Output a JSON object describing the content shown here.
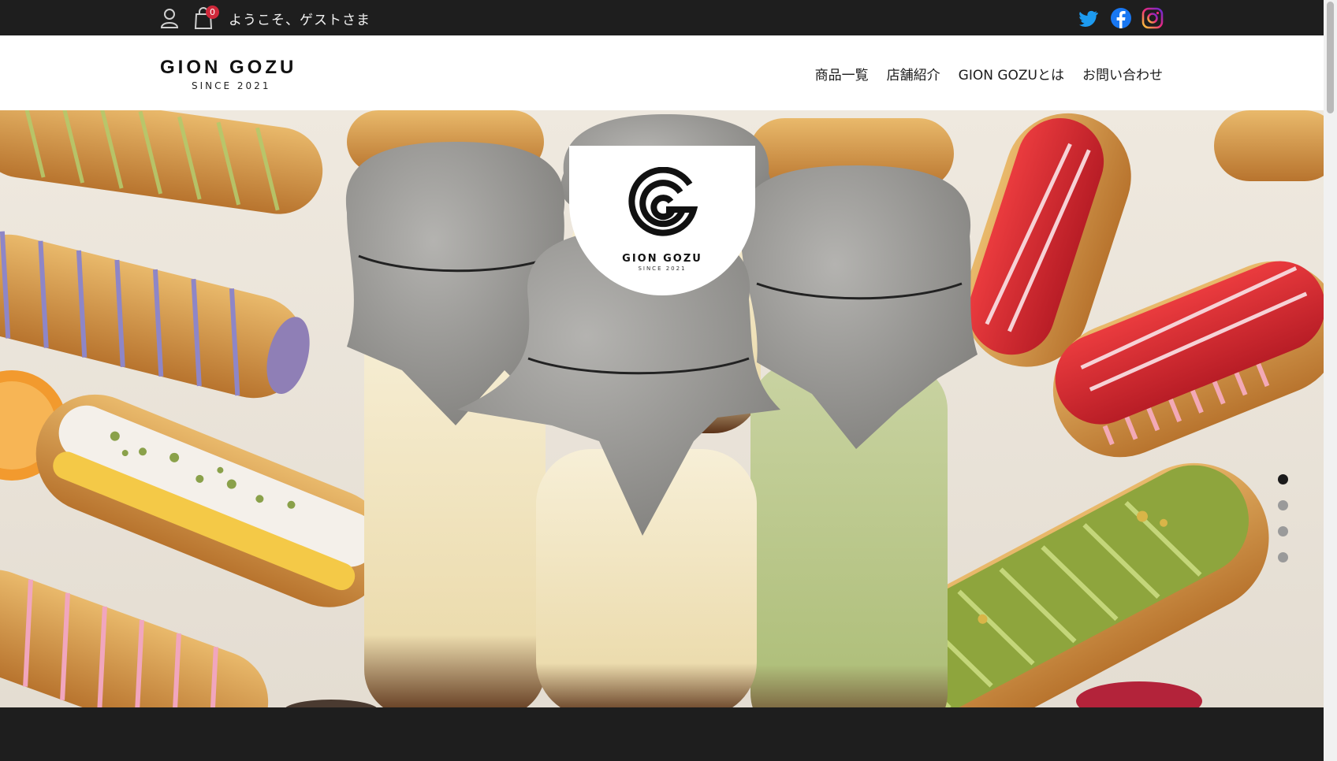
{
  "topbar": {
    "cart_count": "0",
    "welcome": "ようこそ、ゲストさま",
    "icons": [
      "user-icon",
      "cart-icon",
      "twitter-icon",
      "facebook-icon",
      "instagram-icon"
    ],
    "colors": {
      "background": "#1e1e1e",
      "badge": "#d0283a"
    }
  },
  "header": {
    "brand_name": "GION GOZU",
    "brand_since": "SINCE 2021",
    "nav": [
      {
        "label": "商品一覧"
      },
      {
        "label": "店舗紹介"
      },
      {
        "label": "GION GOZUとは"
      },
      {
        "label": "お問い合わせ"
      }
    ]
  },
  "hero": {
    "logo_name": "GION GOZU",
    "logo_since": "SINCE 2021",
    "slides_total": 4,
    "active_slide": 1
  }
}
